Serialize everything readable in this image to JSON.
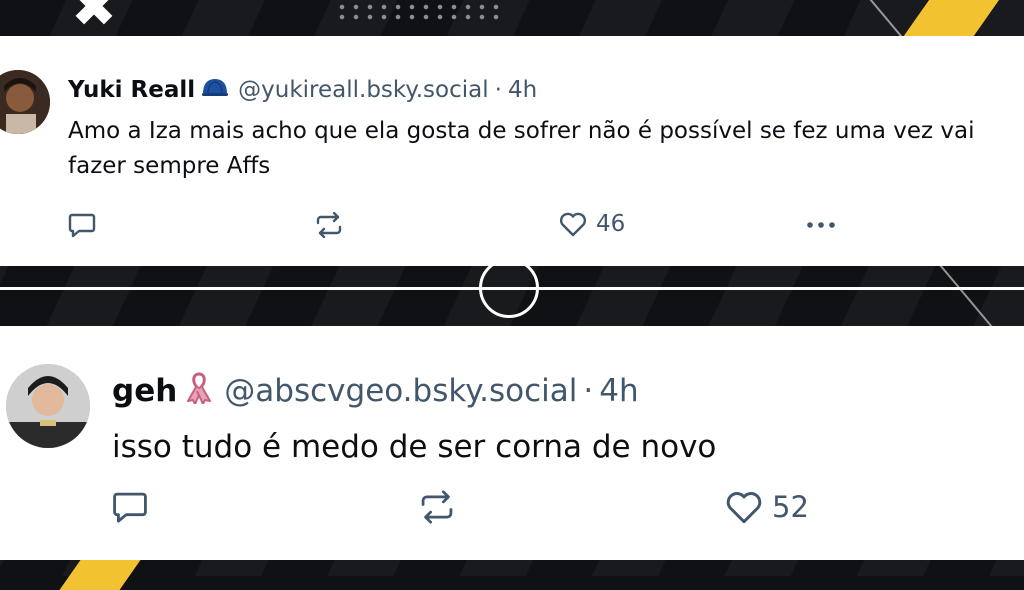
{
  "posts": [
    {
      "name": "Yuki Reall",
      "badge_icon": "blue-cap-emoji",
      "handle": "@yukireall.bsky.social",
      "separator": "·",
      "time": "4h",
      "text": "Amo a Iza mais acho que ela gosta de sofrer não é possível se fez uma vez vai fazer sempre Affs",
      "likes": "46"
    },
    {
      "name": "geh",
      "badge_icon": "pink-ribbon-emoji",
      "handle": "@abscvgeo.bsky.social",
      "separator": "·",
      "time": "4h",
      "text": "isso tudo é medo de ser corna de novo",
      "likes": "52"
    }
  ],
  "colors": {
    "accent_blue": "#1e50a2",
    "muted": "#42576c",
    "ribbon_pink": "#e8a3b8",
    "background": "#0f1114",
    "yellow": "#f2c230"
  }
}
